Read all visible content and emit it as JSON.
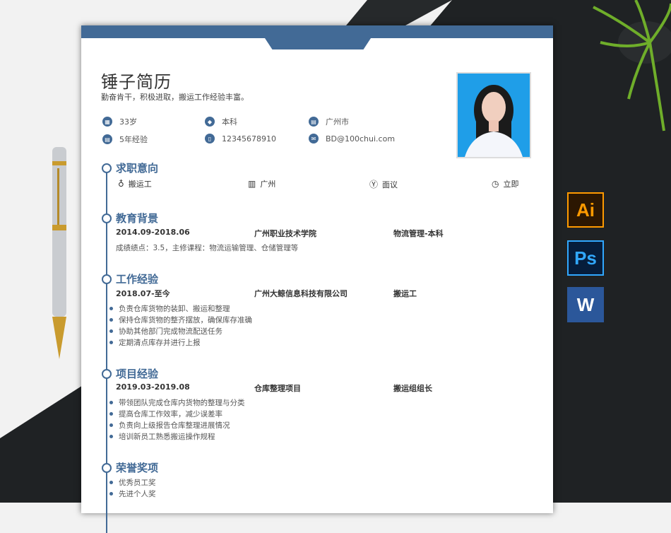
{
  "resume": {
    "name": "锤子简历",
    "tagline": "勤奋肯干，积极进取，搬运工作经验丰富。",
    "info": {
      "age": "33岁",
      "education": "本科",
      "city": "广州市",
      "experience": "5年经验",
      "phone": "12345678910",
      "email": "BD@100chui.com"
    },
    "intent": {
      "title": "求职意向",
      "job": "搬运工",
      "city": "广州",
      "salary": "面议",
      "start": "立即"
    },
    "education": {
      "title": "教育背景",
      "period": "2014.09-2018.06",
      "school": "广州职业技术学院",
      "major": "物流管理-本科",
      "detail": "成绩绩点：3.5，主修课程：物流运输管理、仓储管理等"
    },
    "work": {
      "title": "工作经验",
      "period": "2018.07-至今",
      "company": "广州大鲸信息科技有限公司",
      "role": "搬运工",
      "items": [
        "负责仓库货物的装卸、搬运和整理",
        "保持仓库货物的整齐摆放，确保库存准确",
        "协助其他部门完成物流配送任务",
        "定期清点库存并进行上报"
      ]
    },
    "project": {
      "title": "项目经验",
      "period": "2019.03-2019.08",
      "name": "仓库整理项目",
      "role": "搬运组组长",
      "items": [
        "带领团队完成仓库内货物的整理与分类",
        "提高仓库工作效率，减少误差率",
        "负责向上级报告仓库整理进展情况",
        "培训新员工熟悉搬运操作规程"
      ]
    },
    "honors": {
      "title": "荣誉奖项",
      "items": [
        "优秀员工奖",
        "先进个人奖"
      ]
    }
  },
  "software_icons": {
    "ai": "Ai",
    "ps": "Ps",
    "word": "W"
  },
  "colors": {
    "accent": "#426a96"
  }
}
